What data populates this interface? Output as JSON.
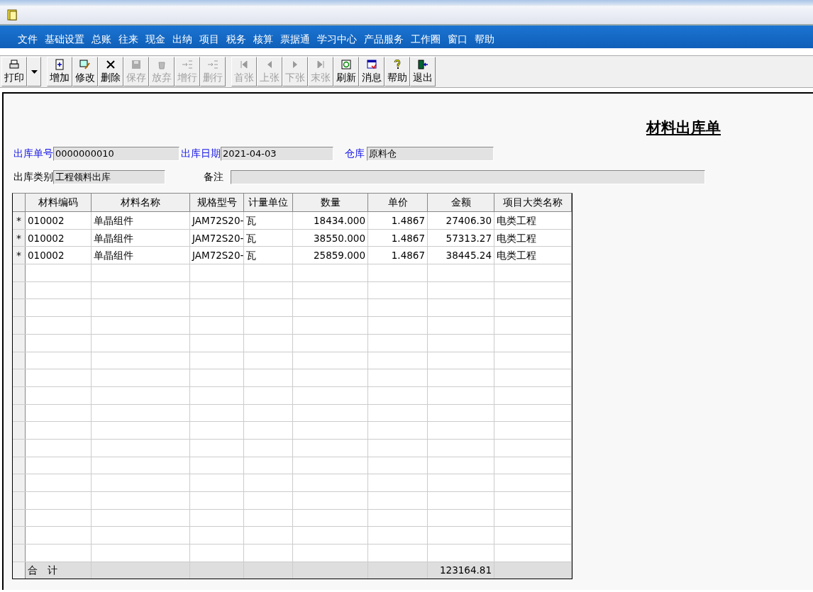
{
  "menu": [
    "文件",
    "基础设置",
    "总账",
    "往来",
    "现金",
    "出纳",
    "项目",
    "税务",
    "核算",
    "票据通",
    "学习中心",
    "产品服务",
    "工作圈",
    "窗口",
    "帮助"
  ],
  "toolbar": [
    {
      "label": "打印",
      "disabled": false
    },
    {
      "label": "增加",
      "disabled": false
    },
    {
      "label": "修改",
      "disabled": false
    },
    {
      "label": "删除",
      "disabled": false
    },
    {
      "label": "保存",
      "disabled": true
    },
    {
      "label": "放弃",
      "disabled": true
    },
    {
      "label": "增行",
      "disabled": true
    },
    {
      "label": "删行",
      "disabled": true
    },
    {
      "label": "首张",
      "disabled": true
    },
    {
      "label": "上张",
      "disabled": true
    },
    {
      "label": "下张",
      "disabled": true
    },
    {
      "label": "末张",
      "disabled": true
    },
    {
      "label": "刷新",
      "disabled": false
    },
    {
      "label": "消息",
      "disabled": false
    },
    {
      "label": "帮助",
      "disabled": false
    },
    {
      "label": "退出",
      "disabled": false
    }
  ],
  "form": {
    "title": "材料出库单",
    "fields": [
      {
        "label": "出库单号",
        "value": "0000000010",
        "required": true
      },
      {
        "label": "出库日期",
        "value": "2021-04-03",
        "required": true
      },
      {
        "label": "仓库",
        "value": "原料仓",
        "required": true
      },
      {
        "label": "出库类别",
        "value": "工程领料出库",
        "required": false
      },
      {
        "label": "备注",
        "required": false
      }
    ]
  },
  "table": {
    "columns": [
      "材料编码",
      "材料名称",
      "规格型号",
      "计量单位",
      "数量",
      "单价",
      "金额",
      "项目大类名称"
    ],
    "rows": [
      {
        "marker": "*",
        "cells": [
          "010002",
          "单晶组件",
          "JAM72S20-",
          "瓦",
          "18434.000",
          "1.4867",
          "27406.30",
          "电类工程"
        ]
      },
      {
        "marker": "*",
        "cells": [
          "010002",
          "单晶组件",
          "JAM72S20-",
          "瓦",
          "38550.000",
          "1.4867",
          "57313.27",
          "电类工程"
        ]
      },
      {
        "marker": "*",
        "cells": [
          "010002",
          "单晶组件",
          "JAM72S20-",
          "瓦",
          "25859.000",
          "1.4867",
          "38445.24",
          "电类工程"
        ]
      }
    ],
    "total": {
      "label": "合　计",
      "amount": "123164.81"
    }
  }
}
